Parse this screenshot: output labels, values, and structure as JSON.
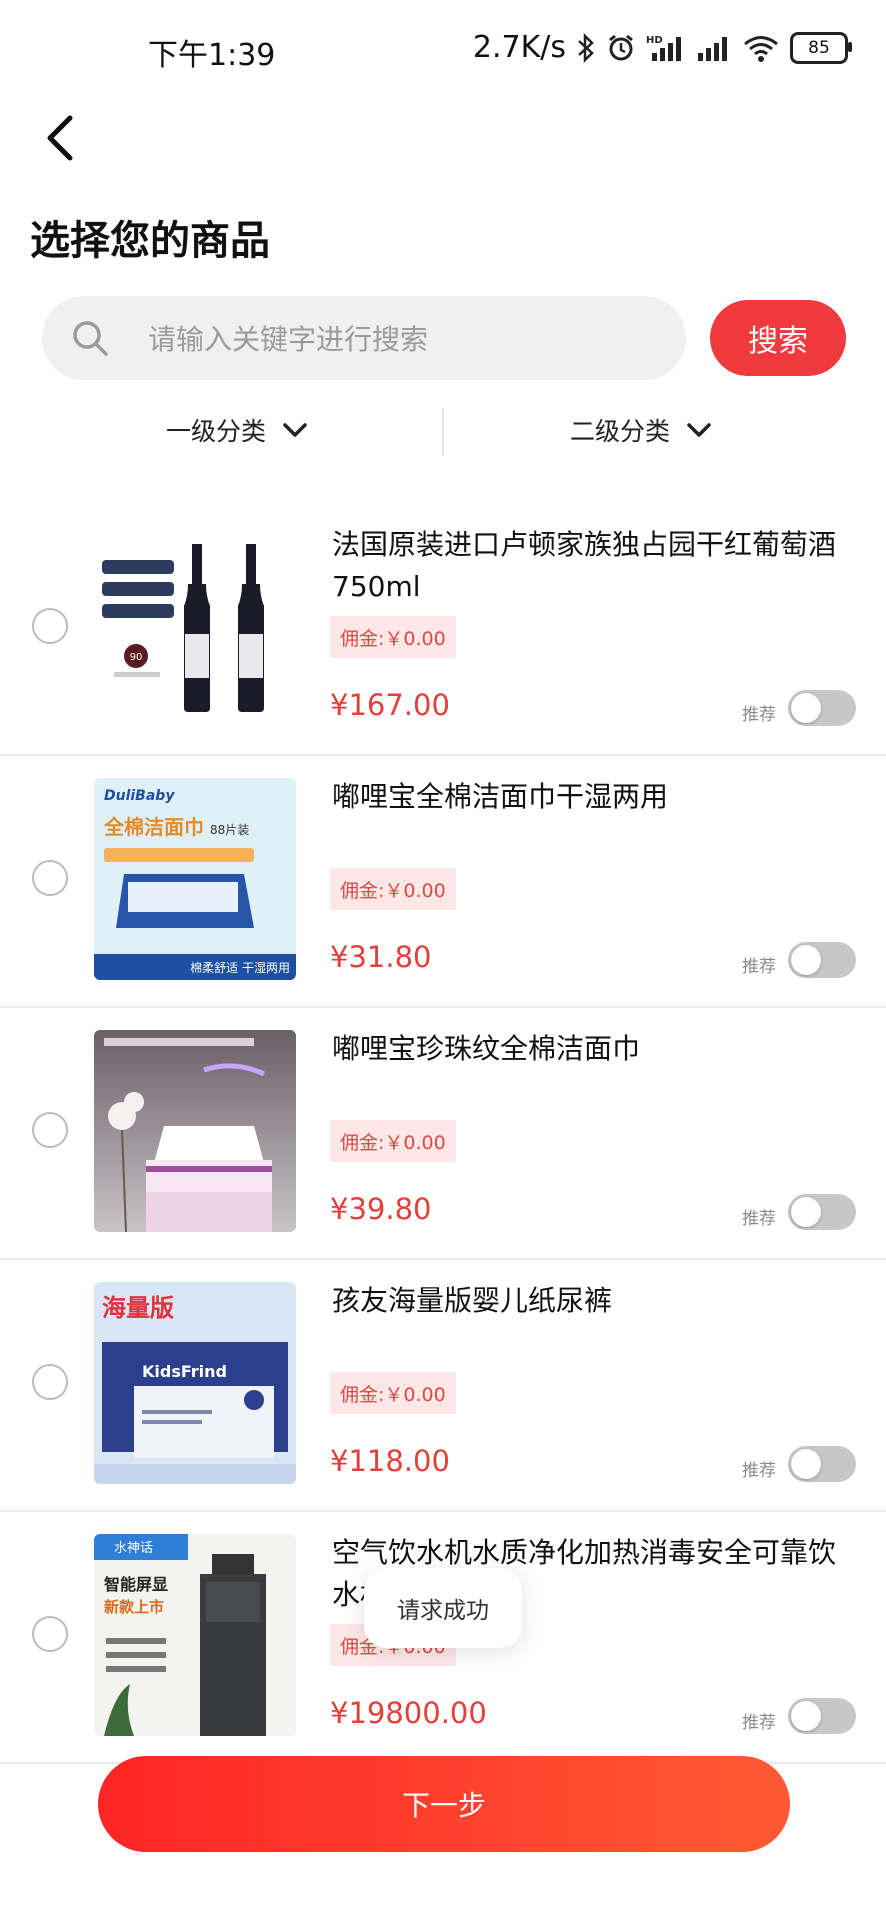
{
  "status_bar": {
    "time": "下午1:39",
    "speed": "2.7K/s",
    "battery": "85"
  },
  "page": {
    "title": "选择您的商品"
  },
  "search": {
    "placeholder": "请输入关键字进行搜索",
    "button_label": "搜索"
  },
  "filters": {
    "level1": "一级分类",
    "level2": "二级分类"
  },
  "products": [
    {
      "name": "法国原装进口卢顿家族独占园干红葡萄酒750ml",
      "commission": "佣金:￥0.00",
      "price": "¥167.00",
      "recommend_label": "推荐"
    },
    {
      "name": "嘟哩宝全棉洁面巾干湿两用",
      "commission": "佣金:￥0.00",
      "price": "¥31.80",
      "recommend_label": "推荐"
    },
    {
      "name": "嘟哩宝珍珠纹全棉洁面巾",
      "commission": "佣金:￥0.00",
      "price": "¥39.80",
      "recommend_label": "推荐"
    },
    {
      "name": "孩友海量版婴儿纸尿裤",
      "commission": "佣金:￥0.00",
      "price": "¥118.00",
      "recommend_label": "推荐"
    },
    {
      "name": "空气饮水机水质净化加热消毒安全可靠饮水机",
      "commission": "佣金:￥0.00",
      "price": "¥19800.00",
      "recommend_label": "推荐"
    }
  ],
  "thumb_texts": {
    "wine_badge": "90",
    "towel_brand": "DuliBaby",
    "towel_title": "全棉洁面巾",
    "towel_count": "88片装",
    "towel_bottom": "棉柔舒适 干湿两用",
    "diaper_title": "海量版",
    "diaper_brand": "KidsFrind",
    "water_brand": "水神话",
    "water_title": "智能屏显",
    "water_sub": "新款上市"
  },
  "toast": "请求成功",
  "next_button": "下一步",
  "colors": {
    "accent": "#f03a3e",
    "price": "#e2403a",
    "commission_bg": "#fde7e7"
  }
}
